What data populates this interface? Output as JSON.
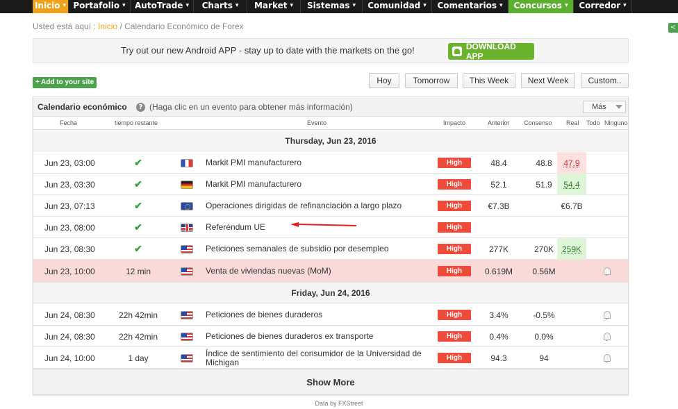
{
  "nav": {
    "items": [
      {
        "label": "Inicio",
        "caret": "▾",
        "style": "active",
        "width": 52
      },
      {
        "label": "Portafolio",
        "caret": "▾",
        "style": "",
        "width": 89
      },
      {
        "label": "AutoTrade",
        "caret": "▾",
        "style": "",
        "width": 91
      },
      {
        "label": "Charts",
        "caret": "▾",
        "style": "",
        "width": 77
      },
      {
        "label": "Market",
        "caret": "▾",
        "style": "",
        "width": 77
      },
      {
        "label": "Sistemas",
        "caret": "▾",
        "style": "",
        "width": 89
      },
      {
        "label": "Comunidad",
        "caret": "▾",
        "style": "",
        "width": 100
      },
      {
        "label": "Comentarios",
        "caret": "▾",
        "style": "",
        "width": 110
      },
      {
        "label": "Concursos",
        "caret": "▾",
        "style": "green",
        "width": 94
      },
      {
        "label": "Corredor",
        "caret": "▾",
        "style": "",
        "width": 84
      }
    ]
  },
  "breadcrumb": {
    "prefix": "Usted está aquí :",
    "home": "Inicio",
    "sep": "/",
    "current": "Calendario Económico de Forex"
  },
  "banner": {
    "text": "Try out our new Android APP - stay up to date with the markets on the go!",
    "download_label": "DOWNLOAD APP"
  },
  "add_site_label": "+ Add to your site",
  "range_buttons": {
    "today": "Hoy",
    "tomorrow": "Tomorrow",
    "week": "This Week",
    "next_week": "Next Week",
    "custom": "Custom.."
  },
  "panel": {
    "title": "Calendario económico",
    "hint": "(Haga clic en un evento para obtener más información)",
    "more_label": "Más",
    "help": "?"
  },
  "columns": {
    "date": "Fecha",
    "remaining": "tiempo restante",
    "event": "Evento",
    "impact": "Impacto",
    "previous": "Anterior",
    "consensus": "Consenso",
    "actual": "Real",
    "all": "Todo",
    "none": "Ninguno"
  },
  "days": [
    {
      "label": "Thursday, Jun 23, 2016"
    },
    {
      "label": "Friday, Jun 24, 2016"
    }
  ],
  "events": [
    {
      "date": "Jun 23, 03:00",
      "remaining": "✔",
      "flag": "fr",
      "event": "Markit PMI manufacturero",
      "impact": "High",
      "previous": "48.4",
      "consensus": "48.8",
      "actual": "47.9",
      "actual_state": "red",
      "alert": false,
      "highlight": false
    },
    {
      "date": "Jun 23, 03:30",
      "remaining": "✔",
      "flag": "de",
      "event": "Markit PMI manufacturero",
      "impact": "High",
      "previous": "52.1",
      "consensus": "51.9",
      "actual": "54.4",
      "actual_state": "green",
      "alert": false,
      "highlight": false
    },
    {
      "date": "Jun 23, 07:13",
      "remaining": "✔",
      "flag": "eu",
      "event": "Operaciones dirigidas de refinanciación a largo plazo",
      "impact": "High",
      "previous": "€7.3B",
      "consensus": "",
      "actual": "€6.7B",
      "actual_state": "",
      "alert": false,
      "highlight": false
    },
    {
      "date": "Jun 23, 08:00",
      "remaining": "✔",
      "flag": "uk",
      "event": "Referéndum UE",
      "impact": "High",
      "previous": "",
      "consensus": "",
      "actual": "",
      "actual_state": "",
      "alert": false,
      "highlight": false
    },
    {
      "date": "Jun 23, 08:30",
      "remaining": "✔",
      "flag": "us",
      "event": "Peticiones semanales de subsidio por desempleo",
      "impact": "High",
      "previous": "277K",
      "consensus": "270K",
      "actual": "259K",
      "actual_state": "green",
      "alert": false,
      "highlight": false
    },
    {
      "date": "Jun 23, 10:00",
      "remaining": "12 min",
      "flag": "us",
      "event": "Venta de viviendas nuevas (MoM)",
      "impact": "High",
      "previous": "0.619M",
      "consensus": "0.56M",
      "actual": "",
      "actual_state": "",
      "alert": true,
      "highlight": true
    },
    {
      "date": "Jun 24, 08:30",
      "remaining": "22h 42min",
      "flag": "us",
      "event": "Peticiones de bienes duraderos",
      "impact": "High",
      "previous": "3.4%",
      "consensus": "-0.5%",
      "actual": "",
      "actual_state": "",
      "alert": true,
      "highlight": false
    },
    {
      "date": "Jun 24, 08:30",
      "remaining": "22h 42min",
      "flag": "us",
      "event": "Peticiones de bienes duraderos ex transporte",
      "impact": "High",
      "previous": "0.4%",
      "consensus": "0.0%",
      "actual": "",
      "actual_state": "",
      "alert": true,
      "highlight": false
    },
    {
      "date": "Jun 24, 10:00",
      "remaining": "1 day",
      "flag": "us",
      "event": "Índice de sentimiento del consumidor de la Universidad de Michigan",
      "impact": "High",
      "previous": "94.3",
      "consensus": "94",
      "actual": "",
      "actual_state": "",
      "alert": true,
      "highlight": false
    }
  ],
  "show_more_label": "Show More",
  "credits": "Data by FXStreet",
  "share_icon": "share-icon",
  "share_glyph": "<",
  "colors": {
    "accent_orange": "#f0a21b",
    "accent_green": "#5cae2e",
    "impact_high": "#ef4a3a",
    "highlight_row": "#fbdada"
  }
}
